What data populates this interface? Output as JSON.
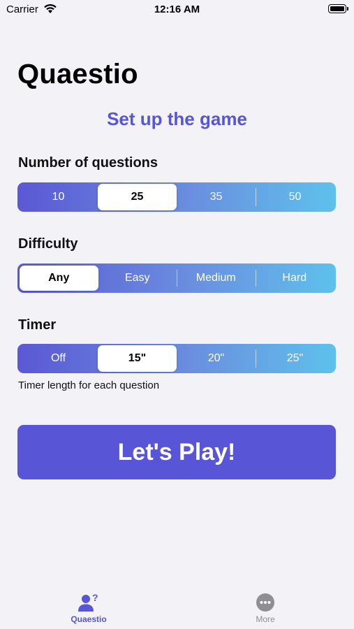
{
  "status_bar": {
    "carrier": "Carrier",
    "time": "12:16 AM"
  },
  "app_title": "Quaestio",
  "subtitle": "Set up the game",
  "questions": {
    "label": "Number of questions",
    "options": [
      "10",
      "25",
      "35",
      "50"
    ],
    "selected": "25"
  },
  "difficulty": {
    "label": "Difficulty",
    "options": [
      "Any",
      "Easy",
      "Medium",
      "Hard"
    ],
    "selected": "Any"
  },
  "timer": {
    "label": "Timer",
    "options": [
      "Off",
      "15\"",
      "20\"",
      "25\""
    ],
    "selected": "15\"",
    "helper": "Timer length for each question"
  },
  "play_button": "Let's Play!",
  "tabs": [
    {
      "label": "Quaestio",
      "icon": "person-question-icon",
      "active": true
    },
    {
      "label": "More",
      "icon": "more-icon",
      "active": false
    }
  ],
  "colors": {
    "accent": "#5856d6",
    "gradient_start": "#5b58d4",
    "gradient_end": "#5ec1ec",
    "background": "#f2f2f7"
  }
}
